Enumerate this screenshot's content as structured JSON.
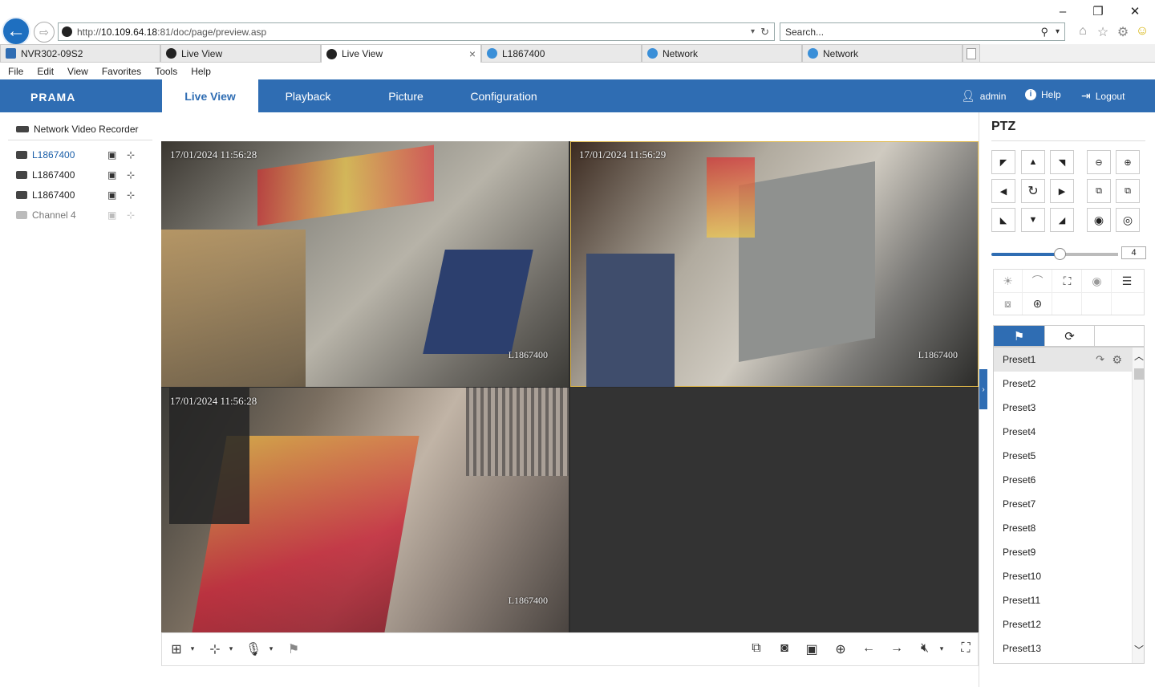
{
  "window": {
    "minimize": "–",
    "restore": "❐",
    "close": "✕"
  },
  "browser": {
    "url_prefix": "http://",
    "url_host": "10.109.64.18",
    "url_rest": ":81/doc/page/preview.asp",
    "search_placeholder": "Search...",
    "tabs": [
      {
        "label": "NVR302-09S2",
        "icon_color": "#2f6db3"
      },
      {
        "label": "Live View",
        "icon_color": "#222"
      },
      {
        "label": "Live View",
        "icon_color": "#222",
        "active": true
      },
      {
        "label": "L1867400",
        "icon_color": "#3a8fd8"
      },
      {
        "label": "Network",
        "icon_color": "#3a8fd8"
      },
      {
        "label": "Network",
        "icon_color": "#3a8fd8"
      }
    ],
    "tab_close": "×",
    "menu": [
      "File",
      "Edit",
      "View",
      "Favorites",
      "Tools",
      "Help"
    ]
  },
  "app": {
    "logo": "PRAMA",
    "nav": [
      {
        "label": "Live View",
        "active": true
      },
      {
        "label": "Playback"
      },
      {
        "label": "Picture"
      },
      {
        "label": "Configuration"
      }
    ],
    "user": "admin",
    "help": "Help",
    "logout": "Logout",
    "accent": "#2f6db3"
  },
  "tree": {
    "title": "Network Video Recorder",
    "channels": [
      {
        "label": "L1867400",
        "selected": true
      },
      {
        "label": "L1867400"
      },
      {
        "label": "L1867400"
      },
      {
        "label": "Channel 4",
        "disabled": true
      }
    ]
  },
  "video": {
    "panes": [
      {
        "timestamp": "17/01/2024 11:56:28",
        "name": "L1867400"
      },
      {
        "timestamp": "17/01/2024 11:56:29",
        "name": "L1867400"
      },
      {
        "timestamp": "17/01/2024 11:56:28",
        "name": "L1867400"
      }
    ]
  },
  "ptz": {
    "title": "PTZ",
    "speed": "4",
    "speed_fraction": 0.5,
    "presets": [
      "Preset1",
      "Preset2",
      "Preset3",
      "Preset4",
      "Preset5",
      "Preset6",
      "Preset7",
      "Preset8",
      "Preset9",
      "Preset10",
      "Preset11",
      "Preset12",
      "Preset13"
    ]
  }
}
